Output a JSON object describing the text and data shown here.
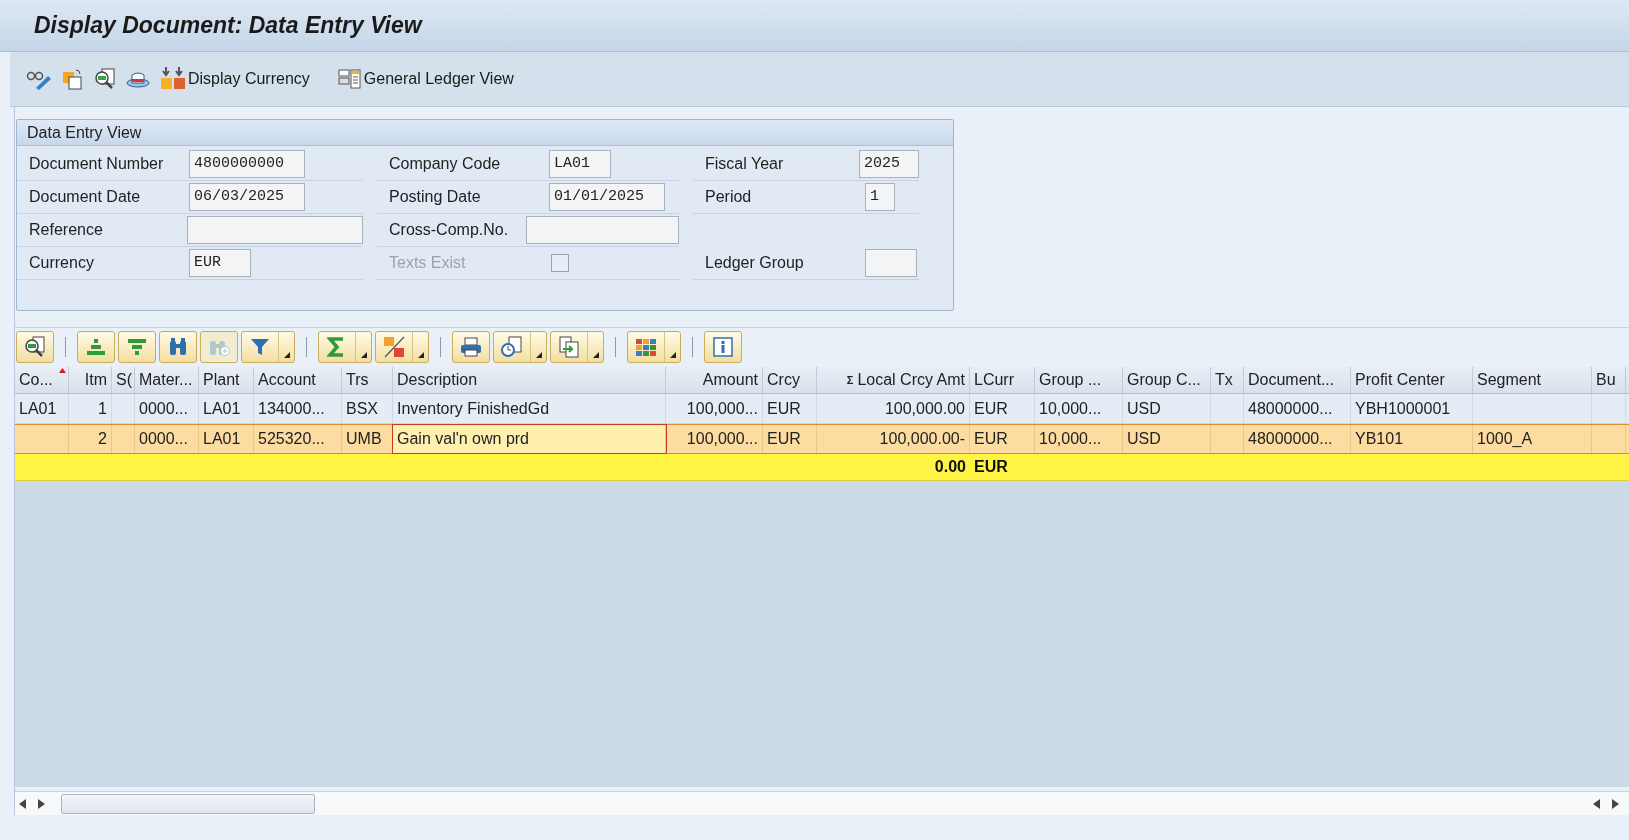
{
  "window": {
    "title": "Display Document: Data Entry View"
  },
  "toolbar": [
    {
      "kind": "glasses-pencil"
    },
    {
      "kind": "copy"
    },
    {
      "kind": "zoom-doc"
    },
    {
      "kind": "hat"
    },
    {
      "kind": "currency",
      "label": "Display Currency"
    },
    {
      "kind": "ledger",
      "label": "General Ledger View"
    }
  ],
  "panel": {
    "title": "Data Entry View",
    "fields": [
      {
        "label": "Document Number",
        "value": "4800000000"
      },
      {
        "label": "Company Code",
        "value": "LA01"
      },
      {
        "label": "Fiscal Year",
        "value": "2025"
      },
      {
        "label": "Document Date",
        "value": "06/03/2025"
      },
      {
        "label": "Posting Date",
        "value": "01/01/2025"
      },
      {
        "label": "Period",
        "value": "1"
      },
      {
        "label": "Reference"
      },
      {
        "label": "Cross-Comp.No."
      },
      {
        "kind": "empty"
      },
      {
        "label": "Currency",
        "value": "EUR"
      },
      {
        "label": "Texts Exist",
        "kind": "checkbox",
        "checked": false,
        "disabled": true
      },
      {
        "label": "Ledger Group"
      }
    ]
  },
  "alv_toolbar": [
    {
      "kind": "details",
      "dropdown": false,
      "disabled": false
    },
    {
      "kind": "separator"
    },
    {
      "kind": "sort-asc",
      "dropdown": false,
      "disabled": false
    },
    {
      "kind": "sort-desc",
      "dropdown": false,
      "disabled": false
    },
    {
      "kind": "find",
      "dropdown": false,
      "disabled": false
    },
    {
      "kind": "find-next",
      "dropdown": false,
      "disabled": true
    },
    {
      "kind": "filter",
      "dropdown": true,
      "disabled": false
    },
    {
      "kind": "separator"
    },
    {
      "kind": "sum",
      "dropdown": true,
      "disabled": false
    },
    {
      "kind": "subtotal",
      "dropdown": true,
      "disabled": false
    },
    {
      "kind": "separator"
    },
    {
      "kind": "print",
      "dropdown": false,
      "disabled": false
    },
    {
      "kind": "views",
      "dropdown": true,
      "disabled": false
    },
    {
      "kind": "export",
      "dropdown": true,
      "disabled": false
    },
    {
      "kind": "separator"
    },
    {
      "kind": "layout",
      "dropdown": true,
      "disabled": false
    },
    {
      "kind": "separator"
    },
    {
      "kind": "info",
      "dropdown": false,
      "disabled": false
    }
  ],
  "table": {
    "columns": [
      {
        "label": "Co...",
        "sorted": true
      },
      {
        "label": "Itm",
        "sorted": false
      },
      {
        "label": "S(",
        "sorted": false
      },
      {
        "label": "Mater...",
        "sorted": false
      },
      {
        "label": "Plant",
        "sorted": false
      },
      {
        "label": "Account",
        "sorted": false
      },
      {
        "label": "Trs",
        "sorted": false
      },
      {
        "label": "Description",
        "sorted": false
      },
      {
        "label": "Amount",
        "sorted": false
      },
      {
        "label": "Crcy",
        "sorted": false
      },
      {
        "label": "Local Crcy Amt",
        "sum_mark": "Σ",
        "sorted": false
      },
      {
        "label": "LCurr",
        "sorted": false
      },
      {
        "label": "Group ...",
        "sorted": false
      },
      {
        "label": "Group C...",
        "sorted": false
      },
      {
        "label": "Tx",
        "sorted": false
      },
      {
        "label": "Document...",
        "sorted": false
      },
      {
        "label": "Profit Center",
        "sorted": false
      },
      {
        "label": "Segment",
        "sorted": false
      },
      {
        "label": "Bu",
        "sorted": false
      }
    ],
    "rows": [
      {
        "selected": false,
        "focused": false,
        "company_code": "LA01",
        "item": "1",
        "material": "0000...",
        "plant": "LA01",
        "account": "134000...",
        "transaction": "BSX",
        "description": "Inventory FinishedGd",
        "amount": "100,000...",
        "currency": "EUR",
        "local_amount": "100,000.00",
        "local_currency": "EUR",
        "group_amount": "10,000...",
        "group_currency": "USD",
        "document": "48000000...",
        "profit_center": "YBH1000001"
      },
      {
        "selected": true,
        "focused": true,
        "item": "2",
        "material": "0000...",
        "plant": "LA01",
        "account": "525320...",
        "transaction": "UMB",
        "description": "Gain val'n own prd",
        "amount": "100,000...",
        "currency": "EUR",
        "local_amount": "100,000.00-",
        "local_currency": "EUR",
        "group_amount": "10,000...",
        "group_currency": "USD",
        "document": "48000000...",
        "profit_center": "YB101",
        "segment": "1000_A"
      }
    ],
    "total": {
      "local_amount": "0.00",
      "local_currency": "EUR"
    }
  }
}
